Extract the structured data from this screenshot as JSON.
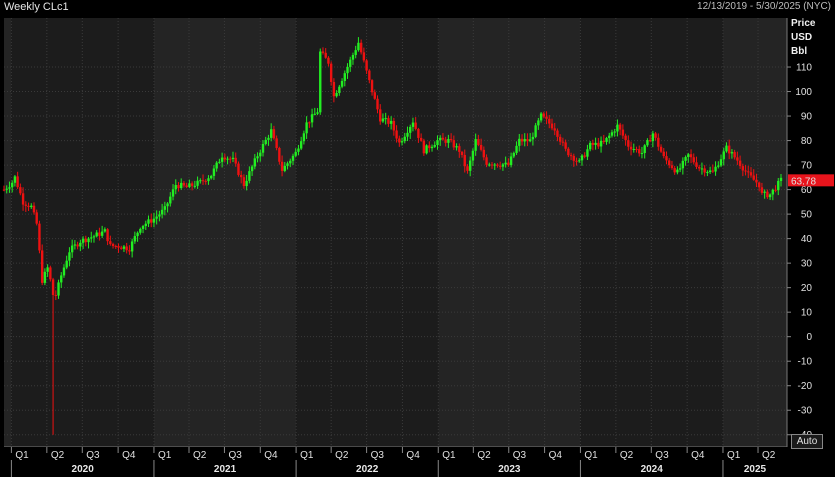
{
  "header": {
    "title": "Weekly CLc1",
    "range": "12/13/2019 - 5/30/2025 (NYC)"
  },
  "auto_label": "Auto",
  "colors": {
    "up": "#22ee22",
    "down": "#ee1111",
    "last_badge": "#e8141c",
    "bg": "#000000",
    "pane": "#1c1c1c",
    "pane_alt": "#242424"
  },
  "chart_data": {
    "type": "candlestick",
    "title": "Weekly CLc1",
    "ylabel": [
      "Price",
      "USD",
      "Bbl"
    ],
    "ylim": [
      -45,
      130
    ],
    "yticks": [
      -40,
      -30,
      -20,
      -10,
      0,
      10,
      20,
      30,
      40,
      50,
      60,
      70,
      80,
      90,
      100,
      110
    ],
    "last_price": "63.78",
    "quarter_ticks": [
      "Q1",
      "Q2",
      "Q3",
      "Q4",
      "Q1",
      "Q2",
      "Q3",
      "Q4",
      "Q1",
      "Q2",
      "Q3",
      "Q4",
      "Q1",
      "Q2",
      "Q3",
      "Q4",
      "Q1",
      "Q2",
      "Q3",
      "Q4",
      "Q1",
      "Q2"
    ],
    "years": [
      "2020",
      "2021",
      "2022",
      "2023",
      "2024",
      "2025"
    ],
    "x_range": [
      "2019-12-13",
      "2025-05-30"
    ],
    "close_path": [
      [
        "2019-12-13",
        60
      ],
      [
        "2020-01-03",
        63
      ],
      [
        "2020-01-10",
        65
      ],
      [
        "2020-01-31",
        55
      ],
      [
        "2020-02-21",
        53
      ],
      [
        "2020-03-06",
        46
      ],
      [
        "2020-03-20",
        23
      ],
      [
        "2020-04-03",
        28
      ],
      [
        "2020-04-17",
        18
      ],
      [
        "2020-04-20",
        -37
      ],
      [
        "2020-04-24",
        17
      ],
      [
        "2020-05-08",
        25
      ],
      [
        "2020-05-29",
        35
      ],
      [
        "2020-06-26",
        39
      ],
      [
        "2020-07-31",
        41
      ],
      [
        "2020-08-28",
        43
      ],
      [
        "2020-09-11",
        37
      ],
      [
        "2020-10-02",
        37
      ],
      [
        "2020-10-30",
        36
      ],
      [
        "2020-11-27",
        45
      ],
      [
        "2020-12-31",
        48
      ],
      [
        "2021-01-29",
        52
      ],
      [
        "2021-02-26",
        62
      ],
      [
        "2021-03-26",
        61
      ],
      [
        "2021-04-30",
        63
      ],
      [
        "2021-05-28",
        66
      ],
      [
        "2021-06-25",
        74
      ],
      [
        "2021-07-23",
        72
      ],
      [
        "2021-08-20",
        62
      ],
      [
        "2021-09-24",
        74
      ],
      [
        "2021-10-29",
        84
      ],
      [
        "2021-11-26",
        68
      ],
      [
        "2021-12-31",
        75
      ],
      [
        "2022-01-28",
        87
      ],
      [
        "2022-02-25",
        92
      ],
      [
        "2022-03-04",
        116
      ],
      [
        "2022-03-25",
        112
      ],
      [
        "2022-04-08",
        98
      ],
      [
        "2022-05-27",
        115
      ],
      [
        "2022-06-10",
        120
      ],
      [
        "2022-07-08",
        104
      ],
      [
        "2022-08-05",
        89
      ],
      [
        "2022-09-02",
        87
      ],
      [
        "2022-09-23",
        79
      ],
      [
        "2022-10-28",
        88
      ],
      [
        "2022-11-25",
        76
      ],
      [
        "2022-12-30",
        80
      ],
      [
        "2023-01-27",
        80
      ],
      [
        "2023-02-24",
        76
      ],
      [
        "2023-03-17",
        67
      ],
      [
        "2023-04-07",
        80
      ],
      [
        "2023-05-05",
        71
      ],
      [
        "2023-06-30",
        70
      ],
      [
        "2023-07-28",
        80
      ],
      [
        "2023-08-25",
        80
      ],
      [
        "2023-09-22",
        90
      ],
      [
        "2023-10-27",
        85
      ],
      [
        "2023-11-24",
        76
      ],
      [
        "2023-12-29",
        71
      ],
      [
        "2024-01-26",
        78
      ],
      [
        "2024-03-01",
        79
      ],
      [
        "2024-04-05",
        86
      ],
      [
        "2024-05-03",
        78
      ],
      [
        "2024-06-07",
        75
      ],
      [
        "2024-07-05",
        83
      ],
      [
        "2024-08-02",
        73
      ],
      [
        "2024-09-06",
        67
      ],
      [
        "2024-10-04",
        74
      ],
      [
        "2024-11-01",
        69
      ],
      [
        "2024-12-06",
        67
      ],
      [
        "2025-01-10",
        77
      ],
      [
        "2025-02-07",
        72
      ],
      [
        "2025-03-07",
        66
      ],
      [
        "2025-04-04",
        62
      ],
      [
        "2025-04-11",
        58
      ],
      [
        "2025-05-02",
        58
      ],
      [
        "2025-05-30",
        63.78
      ]
    ]
  }
}
